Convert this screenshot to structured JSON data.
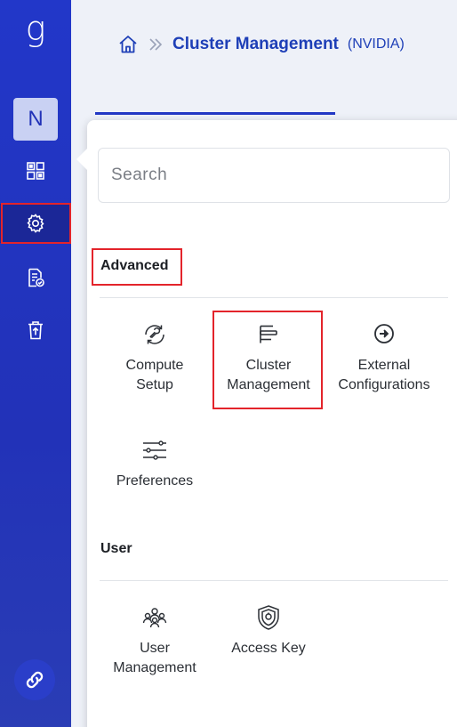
{
  "sidebar": {
    "logo_text": "g",
    "avatar_initial": "N",
    "items": [
      {
        "name": "dashboard-icon",
        "active": false
      },
      {
        "name": "gear-icon",
        "active": true
      },
      {
        "name": "document-check-icon",
        "active": false
      },
      {
        "name": "trash-upload-icon",
        "active": false
      }
    ],
    "bottom_icon": "link-icon"
  },
  "header": {
    "breadcrumb_title": "Cluster Management",
    "breadcrumb_sub": "(NVIDIA)"
  },
  "panel": {
    "search_placeholder": "Search",
    "sections": [
      {
        "title": "Advanced",
        "items": [
          {
            "label_line1": "Compute",
            "label_line2": "Setup",
            "icon": "wrench-cycle-icon"
          },
          {
            "label_line1": "Cluster",
            "label_line2": "Management",
            "icon": "bars-icon"
          },
          {
            "label_line1": "External",
            "label_line2": "Configurations",
            "icon": "arrow-circle-icon"
          },
          {
            "label_line1": "Preferences",
            "label_line2": "",
            "icon": "sliders-icon"
          }
        ]
      },
      {
        "title": "User",
        "items": [
          {
            "label_line1": "User",
            "label_line2": "Management",
            "icon": "users-group-icon"
          },
          {
            "label_line1": "Access Key",
            "label_line2": "",
            "icon": "shield-key-icon"
          }
        ]
      }
    ]
  },
  "colors": {
    "brand": "#2237c9",
    "accent_text": "#1e3fb7",
    "highlight": "#e3242b"
  }
}
